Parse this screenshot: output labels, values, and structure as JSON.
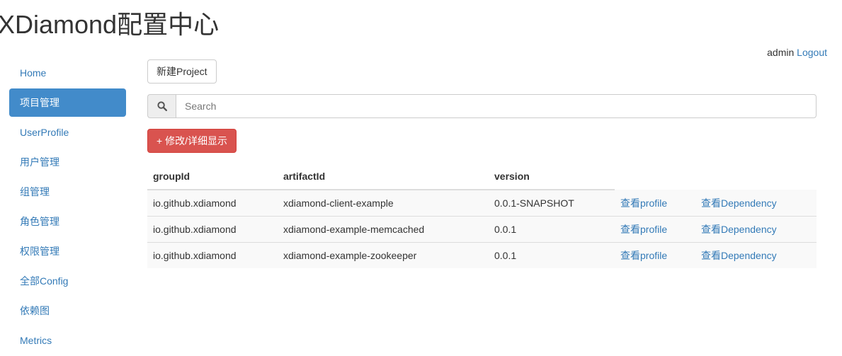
{
  "app": {
    "title": "XDiamond配置中心"
  },
  "user": {
    "name": "admin",
    "logout_label": "Logout"
  },
  "sidebar": {
    "items": [
      {
        "label": "Home"
      },
      {
        "label": "项目管理",
        "active": true
      },
      {
        "label": "UserProfile"
      },
      {
        "label": "用户管理"
      },
      {
        "label": "组管理"
      },
      {
        "label": "角色管理"
      },
      {
        "label": "权限管理"
      },
      {
        "label": "全部Config"
      },
      {
        "label": "依赖图"
      },
      {
        "label": "Metrics"
      }
    ]
  },
  "toolbar": {
    "new_project_label": "新建Project",
    "edit_detail_label": "+ 修改/详细显示"
  },
  "search": {
    "icon": "search-icon",
    "placeholder": "Search",
    "value": ""
  },
  "table": {
    "headers": [
      "groupId",
      "artifactId",
      "version"
    ],
    "rows": [
      {
        "groupId": "io.github.xdiamond",
        "artifactId": "xdiamond-client-example",
        "version": "0.0.1-SNAPSHOT",
        "profile_link": "查看profile",
        "dependency_link": "查看Dependency"
      },
      {
        "groupId": "io.github.xdiamond",
        "artifactId": "xdiamond-example-memcached",
        "version": "0.0.1",
        "profile_link": "查看profile",
        "dependency_link": "查看Dependency"
      },
      {
        "groupId": "io.github.xdiamond",
        "artifactId": "xdiamond-example-zookeeper",
        "version": "0.0.1",
        "profile_link": "查看profile",
        "dependency_link": "查看Dependency"
      }
    ]
  },
  "colors": {
    "link": "#337ab7",
    "active_nav": "#428bca",
    "danger": "#d9534f",
    "striped_row": "#f9f9f9"
  }
}
